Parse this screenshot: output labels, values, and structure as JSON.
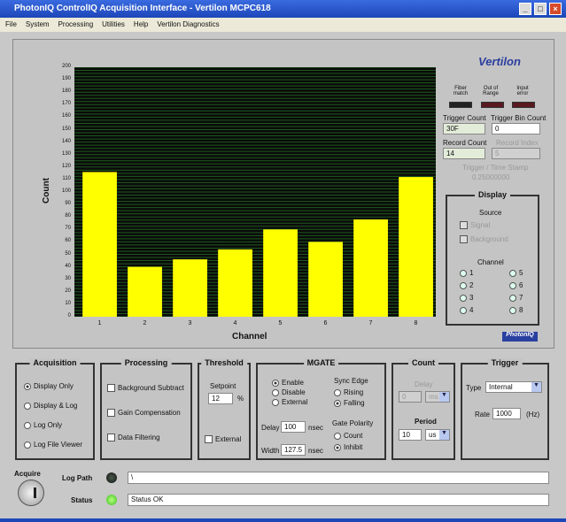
{
  "window": {
    "title": "PhotonIQ ControlIQ Acquisition Interface - Vertilon MCPC618",
    "min": "_",
    "max": "□",
    "close": "×"
  },
  "menu": [
    "File",
    "System",
    "Processing",
    "Utilities",
    "Help",
    "Vertilon Diagnostics"
  ],
  "logo": "Vertilon",
  "logo2": "PhotonIQ",
  "chart_data": {
    "type": "bar",
    "categories": [
      "1",
      "2",
      "3",
      "4",
      "5",
      "6",
      "7",
      "8"
    ],
    "values": [
      116,
      40,
      46,
      54,
      70,
      60,
      78,
      112
    ],
    "xlabel": "Channel",
    "ylabel": "Count",
    "ylim": [
      0,
      200
    ],
    "yticks": [
      "0",
      "10",
      "20",
      "30",
      "40",
      "50",
      "60",
      "70",
      "80",
      "90",
      "100",
      "110",
      "120",
      "130",
      "140",
      "150",
      "160",
      "170",
      "180",
      "190",
      "200"
    ],
    "bar_color": "#ffff00",
    "grid_color": "#1e5a1e",
    "background": "#0a0a0a"
  },
  "indicators": {
    "fiber": "Fiber match",
    "range": "Out of Range",
    "input": "Input error"
  },
  "trigger_count": {
    "label": "Trigger Count",
    "value": "30F"
  },
  "trigger_bin_count": {
    "label": "Trigger Bin Count",
    "value": "0"
  },
  "record_count": {
    "label": "Record Count",
    "value": "14"
  },
  "record_index": {
    "label": "Record Index",
    "value": "5"
  },
  "trigger_time": {
    "label": "Trigger / Time Stamp",
    "value": "0.25000000"
  },
  "display": {
    "title": "Display",
    "source": "Source",
    "signal": "Signal",
    "background": "Background",
    "channel": "Channel",
    "channels": [
      "1",
      "2",
      "3",
      "4",
      "5",
      "6",
      "7",
      "8"
    ]
  },
  "acquisition": {
    "title": "Acquisition",
    "options": [
      "Display Only",
      "Display & Log",
      "Log Only",
      "Log File Viewer"
    ]
  },
  "processing": {
    "title": "Processing",
    "options": [
      "Background Subtract",
      "Gain Compensation",
      "Data Filtering"
    ]
  },
  "threshold": {
    "title": "Threshold",
    "setpoint": "Setpoint",
    "value": "12",
    "unit": "%",
    "external": "External"
  },
  "mgate": {
    "title": "MGATE",
    "modes": [
      "Enable",
      "Disable",
      "External"
    ],
    "sync_edge": "Sync Edge",
    "edges": [
      "Rising",
      "Falling"
    ],
    "gate_polarity": "Gate Polarity",
    "polarity": [
      "Count",
      "Inhibit"
    ],
    "delay_label": "Delay",
    "delay": "100",
    "width_label": "Width",
    "width": "127.5",
    "unit": "nsec"
  },
  "count": {
    "title": "Count",
    "delay": "Delay",
    "delay_value": "0",
    "delay_unit": "ms",
    "period": "Period",
    "period_value": "10",
    "period_unit": "us"
  },
  "trigger": {
    "title": "Trigger",
    "type_label": "Type",
    "type": "Internal",
    "rate_label": "Rate",
    "rate": "1000",
    "rate_unit": "(Hz)"
  },
  "acquire": "Acquire",
  "log_path": {
    "label": "Log Path",
    "value": "\\"
  },
  "status": {
    "label": "Status",
    "value": "Status OK"
  }
}
